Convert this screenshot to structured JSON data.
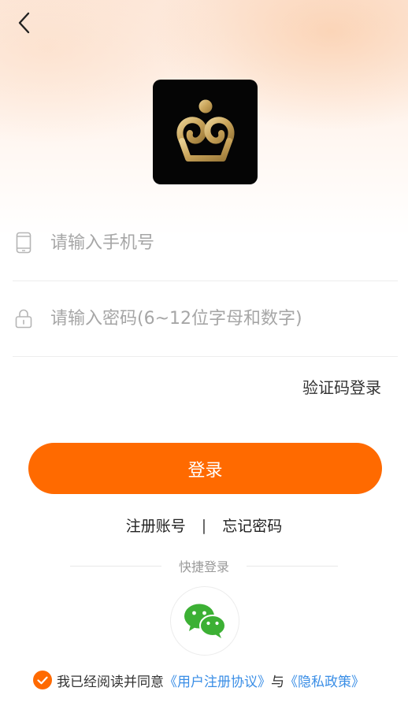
{
  "header": {
    "back_icon": "chevron-left-icon"
  },
  "logo": {
    "icon": "app-logo-icon",
    "bg_color": "#050505",
    "accent_color": "#c9a45a"
  },
  "form": {
    "phone": {
      "placeholder": "请输入手机号",
      "value": "",
      "icon": "phone-icon"
    },
    "password": {
      "placeholder": "请输入密码(6~12位字母和数字)",
      "value": "",
      "icon": "lock-icon"
    },
    "code_login_label": "验证码登录"
  },
  "login_button": {
    "label": "登录",
    "color": "#ff6a00"
  },
  "links": {
    "register": "注册账号",
    "separator": "|",
    "forgot": "忘记密码"
  },
  "quick_login": {
    "label": "快捷登录",
    "wechat_icon": "wechat-icon"
  },
  "agreement": {
    "checked": true,
    "prefix": "我已经阅读并同意",
    "user_agreement": "《用户注册协议》",
    "conjunction": "与",
    "privacy_policy": "《隐私政策》",
    "link_color": "#3a8ee6"
  }
}
